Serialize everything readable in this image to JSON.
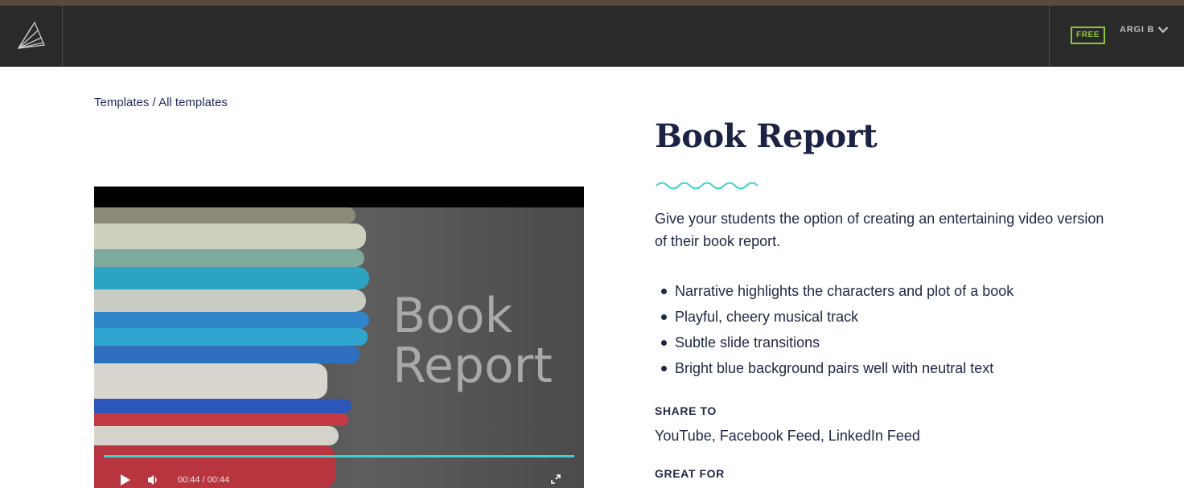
{
  "header": {
    "logo_icon": "paper-fan-logo-icon",
    "plan_badge": "FREE",
    "user_name": "ARGI B",
    "dropdown_icon": "chevron-down-icon"
  },
  "breadcrumb": {
    "root": "Templates",
    "separator": " / ",
    "current": "All templates"
  },
  "video": {
    "overlay_text_line1": "Book",
    "overlay_text_line2": "Report",
    "time_current": "00:44",
    "time_separator": " / ",
    "time_total": "00:44",
    "progress_fraction": 1.0,
    "play_icon": "play-icon",
    "volume_icon": "volume-icon",
    "fullscreen_icon": "fullscreen-icon"
  },
  "template": {
    "title": "Book Report",
    "description": "Give your students the option of creating an entertaining video version of their book report.",
    "features": [
      "Narrative highlights the characters and plot of a book",
      "Playful, cheery musical track",
      "Subtle slide transitions",
      "Bright blue background pairs well with neutral text"
    ],
    "share_label": "SHARE TO",
    "share_value": "YouTube, Facebook Feed, LinkedIn Feed",
    "great_for_label": "GREAT FOR"
  },
  "colors": {
    "accent": "#3fd0cf",
    "badge": "#8cc63f",
    "header_bg": "#2a2a2a",
    "text": "#1f2745"
  }
}
